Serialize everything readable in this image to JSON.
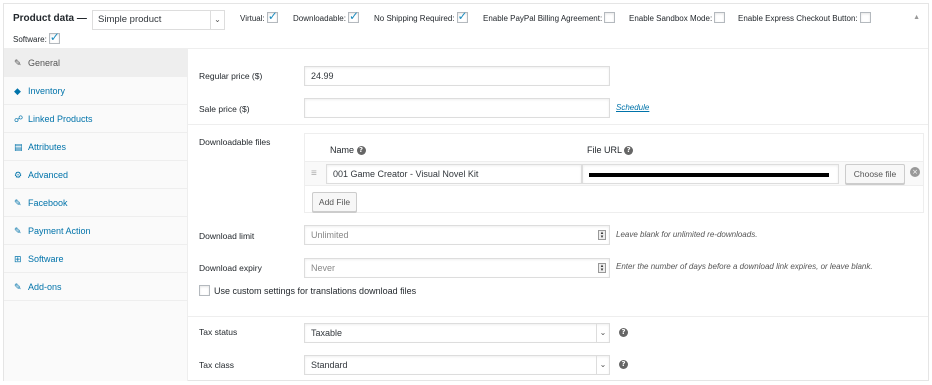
{
  "header": {
    "product_data_label": "Product data —",
    "product_type": "Simple product",
    "options": [
      {
        "label": "Virtual:",
        "checked": true
      },
      {
        "label": "Downloadable:",
        "checked": true
      },
      {
        "label": "No Shipping Required:",
        "checked": true
      },
      {
        "label": "Enable PayPal Billing Agreement:",
        "checked": false
      },
      {
        "label": "Enable Sandbox Mode:",
        "checked": false
      },
      {
        "label": "Enable Express Checkout Button:",
        "checked": false
      }
    ],
    "software_label": "Software:",
    "software_checked": true
  },
  "sidebar": {
    "items": [
      {
        "label": "General",
        "icon": "wrench-icon",
        "active": true
      },
      {
        "label": "Inventory",
        "icon": "tag-icon",
        "active": false
      },
      {
        "label": "Linked Products",
        "icon": "link-icon",
        "active": false
      },
      {
        "label": "Attributes",
        "icon": "list-icon",
        "active": false
      },
      {
        "label": "Advanced",
        "icon": "gear-icon",
        "active": false
      },
      {
        "label": "Facebook",
        "icon": "wrench-icon",
        "active": false
      },
      {
        "label": "Payment Action",
        "icon": "wrench-icon",
        "active": false
      },
      {
        "label": "Software",
        "icon": "grid-icon",
        "active": false
      },
      {
        "label": "Add-ons",
        "icon": "wrench-icon",
        "active": false
      }
    ]
  },
  "general": {
    "regular_price_label": "Regular price ($)",
    "regular_price_value": "24.99",
    "sale_price_label": "Sale price ($)",
    "sale_price_value": "",
    "schedule_link": "Schedule",
    "downloadable_files_label": "Downloadable files",
    "col_name": "Name",
    "col_file_url": "File URL",
    "file_name": "001 Game Creator - Visual Novel Kit",
    "choose_file": "Choose file",
    "add_file": "Add File",
    "download_limit_label": "Download limit",
    "download_limit_placeholder": "Unlimited",
    "download_limit_help": "Leave blank for unlimited re-downloads.",
    "download_expiry_label": "Download expiry",
    "download_expiry_placeholder": "Never",
    "download_expiry_help": "Enter the number of days before a download link expires, or leave blank.",
    "custom_settings_label": "Use custom settings for translations download files",
    "tax_status_label": "Tax status",
    "tax_status_value": "Taxable",
    "tax_class_label": "Tax class",
    "tax_class_value": "Standard"
  }
}
